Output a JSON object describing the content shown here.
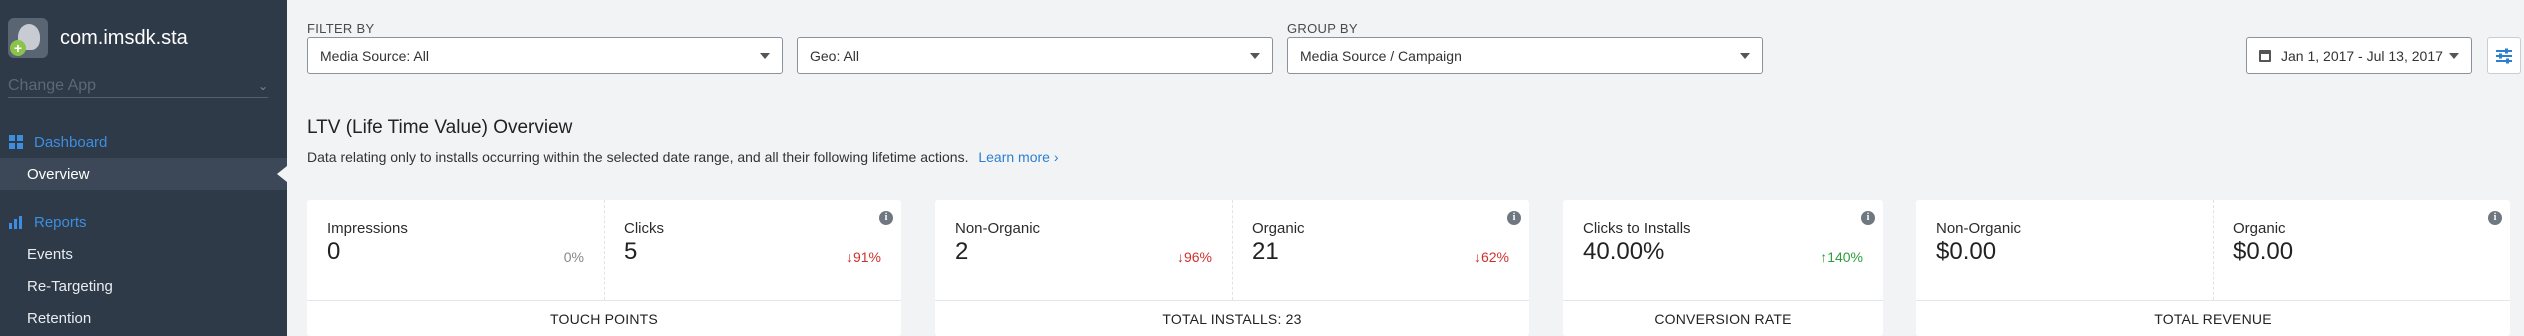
{
  "app": {
    "name": "com.imsdk.sta",
    "change_app_placeholder": "Change App"
  },
  "sidebar": {
    "dashboard": {
      "label": "Dashboard",
      "items": [
        {
          "label": "Overview",
          "active": true
        }
      ]
    },
    "reports": {
      "label": "Reports",
      "items": [
        {
          "label": "Events"
        },
        {
          "label": "Re-Targeting"
        },
        {
          "label": "Retention"
        }
      ]
    }
  },
  "filters": {
    "filter_by_label": "FILTER BY",
    "group_by_label": "GROUP BY",
    "media_source": "Media Source: All",
    "geo": "Geo: All",
    "group_by": "Media Source / Campaign",
    "date_range": "Jan 1, 2017 - Jul 13, 2017"
  },
  "page": {
    "title": "LTV (Life Time Value) Overview",
    "description": "Data relating only to installs occurring within the selected date range, and all their following lifetime actions.",
    "learn_more": "Learn more ›"
  },
  "cards": {
    "touch_points": {
      "footer": "TOUCH POINTS",
      "impressions": {
        "label": "Impressions",
        "value": "0",
        "delta": "0%"
      },
      "clicks": {
        "label": "Clicks",
        "value": "5",
        "delta": "↓91%"
      }
    },
    "installs": {
      "footer": "TOTAL INSTALLS: 23",
      "non_organic": {
        "label": "Non-Organic",
        "value": "2",
        "delta": "↓96%"
      },
      "organic": {
        "label": "Organic",
        "value": "21",
        "delta": "↓62%"
      }
    },
    "conversion": {
      "footer": "CONVERSION RATE",
      "clicks_to_installs": {
        "label": "Clicks to Installs",
        "value": "40.00%",
        "delta": "↑140%"
      }
    },
    "revenue": {
      "footer": "TOTAL REVENUE",
      "non_organic": {
        "label": "Non-Organic",
        "value": "$0.00"
      },
      "organic": {
        "label": "Organic",
        "value": "$0.00"
      }
    }
  },
  "colors": {
    "sidebar_bg": "#2e3a48",
    "accent": "#3d8ee0",
    "negative": "#d0312d",
    "positive": "#2e9e3b"
  }
}
